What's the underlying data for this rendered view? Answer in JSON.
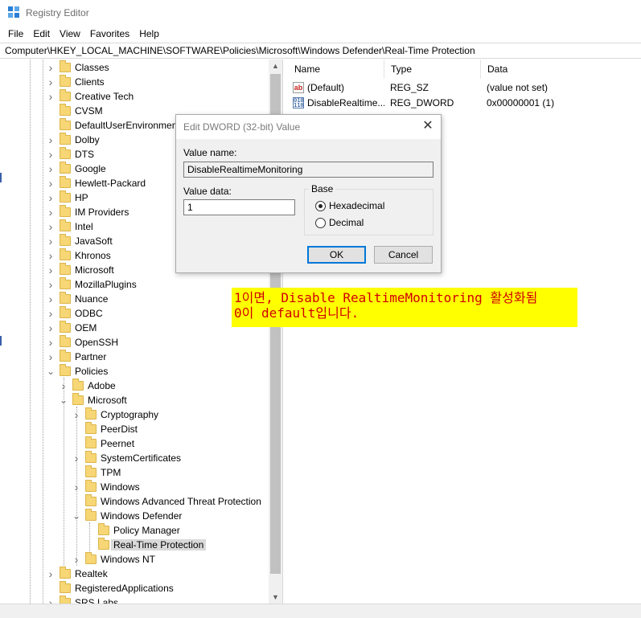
{
  "window": {
    "title": "Registry Editor"
  },
  "menu": [
    "File",
    "Edit",
    "View",
    "Favorites",
    "Help"
  ],
  "address": "Computer\\HKEY_LOCAL_MACHINE\\SOFTWARE\\Policies\\Microsoft\\Windows Defender\\Real-Time Protection",
  "tree": {
    "items": [
      {
        "label": "Classes",
        "depth": 0,
        "chevron": "right"
      },
      {
        "label": "Clients",
        "depth": 0,
        "chevron": "right"
      },
      {
        "label": "Creative Tech",
        "depth": 0,
        "chevron": "right"
      },
      {
        "label": "CVSM",
        "depth": 0,
        "chevron": "none"
      },
      {
        "label": "DefaultUserEnvironment",
        "depth": 0,
        "chevron": "none"
      },
      {
        "label": "Dolby",
        "depth": 0,
        "chevron": "right"
      },
      {
        "label": "DTS",
        "depth": 0,
        "chevron": "right"
      },
      {
        "label": "Google",
        "depth": 0,
        "chevron": "right"
      },
      {
        "label": "Hewlett-Packard",
        "depth": 0,
        "chevron": "right"
      },
      {
        "label": "HP",
        "depth": 0,
        "chevron": "right"
      },
      {
        "label": "IM Providers",
        "depth": 0,
        "chevron": "right"
      },
      {
        "label": "Intel",
        "depth": 0,
        "chevron": "right"
      },
      {
        "label": "JavaSoft",
        "depth": 0,
        "chevron": "right"
      },
      {
        "label": "Khronos",
        "depth": 0,
        "chevron": "right"
      },
      {
        "label": "Microsoft",
        "depth": 0,
        "chevron": "right"
      },
      {
        "label": "MozillaPlugins",
        "depth": 0,
        "chevron": "right"
      },
      {
        "label": "Nuance",
        "depth": 0,
        "chevron": "right"
      },
      {
        "label": "ODBC",
        "depth": 0,
        "chevron": "right"
      },
      {
        "label": "OEM",
        "depth": 0,
        "chevron": "right"
      },
      {
        "label": "OpenSSH",
        "depth": 0,
        "chevron": "right"
      },
      {
        "label": "Partner",
        "depth": 0,
        "chevron": "right"
      },
      {
        "label": "Policies",
        "depth": 0,
        "chevron": "down"
      },
      {
        "label": "Adobe",
        "depth": 1,
        "chevron": "right"
      },
      {
        "label": "Microsoft",
        "depth": 1,
        "chevron": "down"
      },
      {
        "label": "Cryptography",
        "depth": 2,
        "chevron": "right"
      },
      {
        "label": "PeerDist",
        "depth": 2,
        "chevron": "none"
      },
      {
        "label": "Peernet",
        "depth": 2,
        "chevron": "none"
      },
      {
        "label": "SystemCertificates",
        "depth": 2,
        "chevron": "right"
      },
      {
        "label": "TPM",
        "depth": 2,
        "chevron": "none"
      },
      {
        "label": "Windows",
        "depth": 2,
        "chevron": "right"
      },
      {
        "label": "Windows Advanced Threat Protection",
        "depth": 2,
        "chevron": "none"
      },
      {
        "label": "Windows Defender",
        "depth": 2,
        "chevron": "down"
      },
      {
        "label": "Policy Manager",
        "depth": 3,
        "chevron": "none"
      },
      {
        "label": "Real-Time Protection",
        "depth": 3,
        "chevron": "none",
        "selected": true
      },
      {
        "label": "Windows NT",
        "depth": 2,
        "chevron": "right"
      },
      {
        "label": "Realtek",
        "depth": 0,
        "chevron": "right"
      },
      {
        "label": "RegisteredApplications",
        "depth": 0,
        "chevron": "none"
      },
      {
        "label": "SRS Labs",
        "depth": 0,
        "chevron": "right"
      }
    ]
  },
  "list": {
    "columns": [
      "Name",
      "Type",
      "Data"
    ],
    "rows": [
      {
        "icon": "string-value-icon",
        "name": "(Default)",
        "type": "REG_SZ",
        "data": "(value not set)"
      },
      {
        "icon": "binary-value-icon",
        "name": "DisableRealtime...",
        "type": "REG_DWORD",
        "data": "0x00000001 (1)"
      }
    ]
  },
  "dialog": {
    "title": "Edit DWORD (32-bit) Value",
    "value_name_label": "Value name:",
    "value_name": "DisableRealtimeMonitoring",
    "value_data_label": "Value data:",
    "value_data": "1",
    "base_label": "Base",
    "hex_label": "Hexadecimal",
    "dec_label": "Decimal",
    "selected_base": "Hexadecimal",
    "ok_label": "OK",
    "cancel_label": "Cancel"
  },
  "annotation": {
    "line1": "1이면, Disable RealtimeMonitoring 활성화됨",
    "line2": "0이 default입니다."
  }
}
